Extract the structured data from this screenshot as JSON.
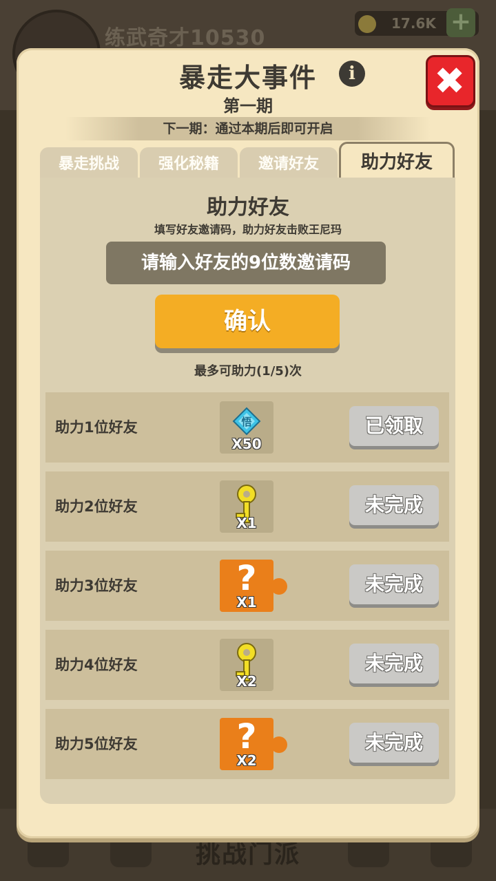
{
  "background": {
    "player_name": "练武奇才10530",
    "coins": "17.6K",
    "plus_label": "+",
    "bottom_label": "挑战门派"
  },
  "dialog": {
    "title": "暴走大事件",
    "info_icon": "i",
    "close_icon": "✖",
    "subtitle": "第一期",
    "next_period": "下一期：通过本期后即可开启",
    "tabs": [
      {
        "label": "暴走挑战",
        "active": false
      },
      {
        "label": "强化秘籍",
        "active": false
      },
      {
        "label": "邀请好友",
        "active": false
      },
      {
        "label": "助力好友",
        "active": true
      }
    ]
  },
  "assist": {
    "title": "助力好友",
    "description": "填写好友邀请码，助力好友击败王尼玛",
    "input_placeholder": "请输入好友的9位数邀请码",
    "input_value": "",
    "confirm_label": "确认",
    "limit_text": "最多可助力(1/5)次"
  },
  "rewards": [
    {
      "label": "助力1位好友",
      "icon": "gem-icon",
      "icon_char": "悟",
      "qty": "X50",
      "status": "已领取"
    },
    {
      "label": "助力2位好友",
      "icon": "key-icon",
      "qty": "X1",
      "status": "未完成"
    },
    {
      "label": "助力3位好友",
      "icon": "puzzle-icon",
      "icon_char": "?",
      "qty": "X1",
      "status": "未完成"
    },
    {
      "label": "助力4位好友",
      "icon": "key-icon",
      "qty": "X2",
      "status": "未完成"
    },
    {
      "label": "助力5位好友",
      "icon": "puzzle-icon",
      "icon_char": "?",
      "qty": "X2",
      "status": "未完成"
    }
  ],
  "colors": {
    "panel": "#f6e7c1",
    "confirm": "#f4ad24",
    "close": "#e8262b",
    "puzzle": "#ea7f1a",
    "key": "#f2de26",
    "gem": "#3ec3e6"
  }
}
